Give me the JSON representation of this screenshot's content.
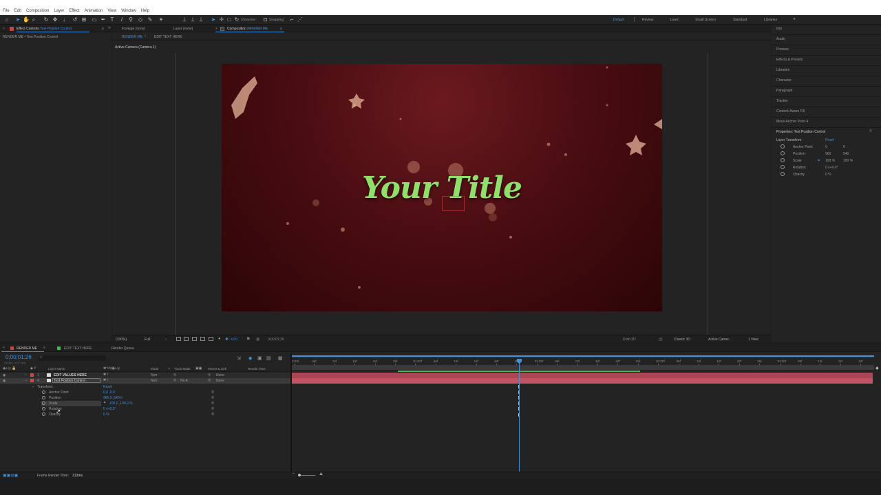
{
  "menu": [
    "File",
    "Edit",
    "Composition",
    "Layer",
    "Effect",
    "Animation",
    "View",
    "Window",
    "Help"
  ],
  "toolbar": {
    "universal": "Universal",
    "snapping": "Snapping"
  },
  "workspaces": [
    {
      "label": "Default",
      "active": true
    },
    {
      "label": "Review"
    },
    {
      "label": "Learn"
    },
    {
      "label": "Small Screen"
    },
    {
      "label": "Standard"
    },
    {
      "label": "Libraries"
    }
  ],
  "left_panel": {
    "tab_prefix": "Effect Controls",
    "tab_name": "Text Position Control",
    "breadcrumb": "RENDER ME • Text Position Control"
  },
  "viewer": {
    "tabs": {
      "footage": "Footage (none)",
      "layer": "Layer (none)",
      "composition_prefix": "Composition",
      "composition_name": "RENDER ME"
    },
    "subtabs": [
      "RENDER ME",
      "EDIT TEXT HERE"
    ],
    "camera_label": "Active Camera (Camera 1)",
    "title_text": "Your Title",
    "footer": {
      "zoom": "(100%)",
      "resolution": "Full",
      "exposure": "+0.0",
      "timecode": "0;00;01;26",
      "renderer": "Draft 3D",
      "view_3d": "Classic 3D",
      "camera": "Active Camer...",
      "views": "1 View"
    }
  },
  "right_panel": {
    "items": [
      "Info",
      "Audio",
      "Preview",
      "Effects & Presets",
      "Libraries",
      "Character",
      "Paragraph",
      "Tracker",
      "Content-Aware Fill",
      "Move Anchor Point 4"
    ],
    "properties_header": "Properties: Text Position Control",
    "layer_transform": "Layer Transform",
    "reset": "Reset",
    "rows": [
      {
        "label": "Anchor Point",
        "v1": "0",
        "v2": "0"
      },
      {
        "label": "Position",
        "v1": "960",
        "v2": "540"
      },
      {
        "label": "Scale",
        "v1": "100 %",
        "v2": "100 %"
      },
      {
        "label": "Rotation",
        "v1": "0 x+0.0°",
        "v2": ""
      },
      {
        "label": "Opacity",
        "v1": "0 %",
        "v2": ""
      }
    ]
  },
  "timeline": {
    "tabs": [
      "RENDER ME",
      "EDIT TEXT HERE",
      "Render Queue"
    ],
    "timecode": "0;00;01;26",
    "fps": "00056 (29.97 fps)",
    "columns": {
      "layer_name": "Layer Name",
      "mode": "Mode",
      "t": "T",
      "track_matte": "Track Matte",
      "parent": "Parent & Link",
      "render_time": "Render Time"
    },
    "layers": [
      {
        "num": "1",
        "name": "EDIT VALUES HERE",
        "mode": "Norr",
        "matte": "",
        "parent": "None",
        "color": "#c94a4a"
      },
      {
        "num": "4",
        "name": "Text Position Control",
        "mode": "Norr",
        "matte": "No A",
        "parent": "None",
        "color": "#c94a4a"
      }
    ],
    "transform_label": "Transform",
    "transform_reset": "Reset",
    "props": [
      {
        "label": "Anchor Point",
        "value": "0,0 ,0,0"
      },
      {
        "label": "Position",
        "value": "960,0 ,540,0"
      },
      {
        "label": "Scale",
        "value": "100,0 ,100,0 %"
      },
      {
        "label": "Rotation",
        "value": "0 x+0,0°"
      },
      {
        "label": "Opacity",
        "value": "0 %"
      }
    ],
    "ruler": [
      "0:00f",
      "05f",
      "10f",
      "15f",
      "20f",
      "25f",
      "01:00f",
      "05f",
      "10f",
      "15f",
      "20f",
      "25f",
      "02:00f",
      "05f",
      "10f",
      "15f",
      "20f",
      "25f",
      "03:00f",
      "05f",
      "10f",
      "15f",
      "20f",
      "25f",
      "04:00f",
      "05f",
      "10f",
      "15f",
      "20f"
    ],
    "footer": {
      "label": "Frame Render Time:",
      "value": "313ms"
    }
  },
  "colors": {
    "accent": "#3f8fd9",
    "title_green": "#8ee06a",
    "layer_bar": "#b84a55",
    "bg_dark": "#1d1d1d",
    "panel": "#232323"
  }
}
